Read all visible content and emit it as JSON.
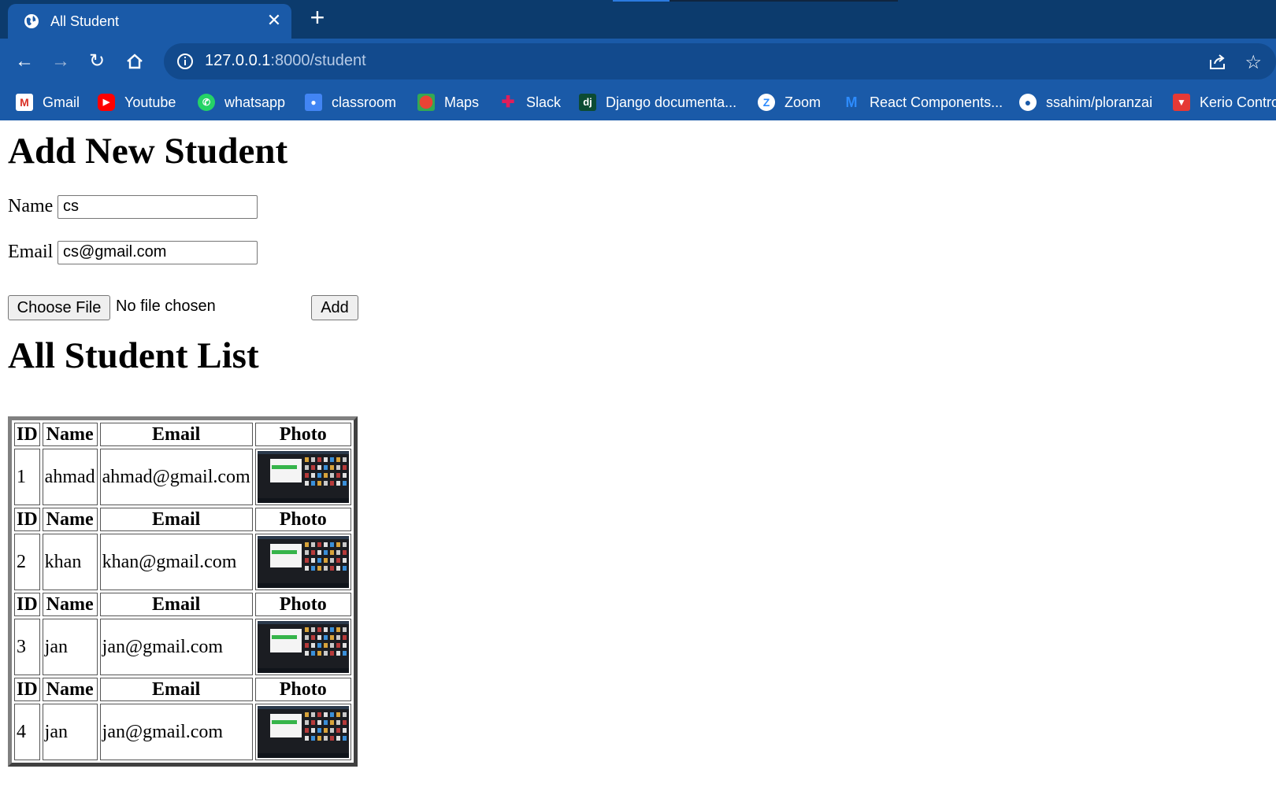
{
  "browser": {
    "tab_title": "All Student",
    "url_host": "127.0.0.1",
    "url_rest": ":8000/student",
    "bookmarks": [
      {
        "label": "Gmail",
        "icon": "gmail-icon"
      },
      {
        "label": "Youtube",
        "icon": "youtube-icon"
      },
      {
        "label": "whatsapp",
        "icon": "whatsapp-icon"
      },
      {
        "label": "classroom",
        "icon": "classroom-icon"
      },
      {
        "label": "Maps",
        "icon": "maps-icon"
      },
      {
        "label": "Slack",
        "icon": "slack-icon"
      },
      {
        "label": "Django documenta...",
        "icon": "django-icon"
      },
      {
        "label": "Zoom",
        "icon": "zoom-icon"
      },
      {
        "label": "React Components...",
        "icon": "react-components-icon"
      },
      {
        "label": "ssahim/ploranzai",
        "icon": "github-icon"
      },
      {
        "label": "Kerio Contro",
        "icon": "kerio-icon"
      }
    ]
  },
  "page": {
    "form_heading": "Add New Student",
    "name_label": "Name",
    "name_value": "cs",
    "email_label": "Email",
    "email_value": "cs@gmail.com",
    "file_button": "Choose File",
    "file_status": "No file chosen",
    "add_button": "Add",
    "list_heading": "All Student List"
  },
  "table": {
    "headers": [
      "ID",
      "Name",
      "Email",
      "Photo"
    ],
    "rows": [
      {
        "id": "1",
        "name": "ahmad",
        "email": "ahmad@gmail.com"
      },
      {
        "id": "2",
        "name": "khan",
        "email": "khan@gmail.com"
      },
      {
        "id": "3",
        "name": "jan",
        "email": "jan@gmail.com"
      },
      {
        "id": "4",
        "name": "jan",
        "email": "jan@gmail.com"
      }
    ]
  },
  "colors": {
    "tabstrip": "#0c3b6d",
    "toolbar": "#1a5aa8"
  }
}
